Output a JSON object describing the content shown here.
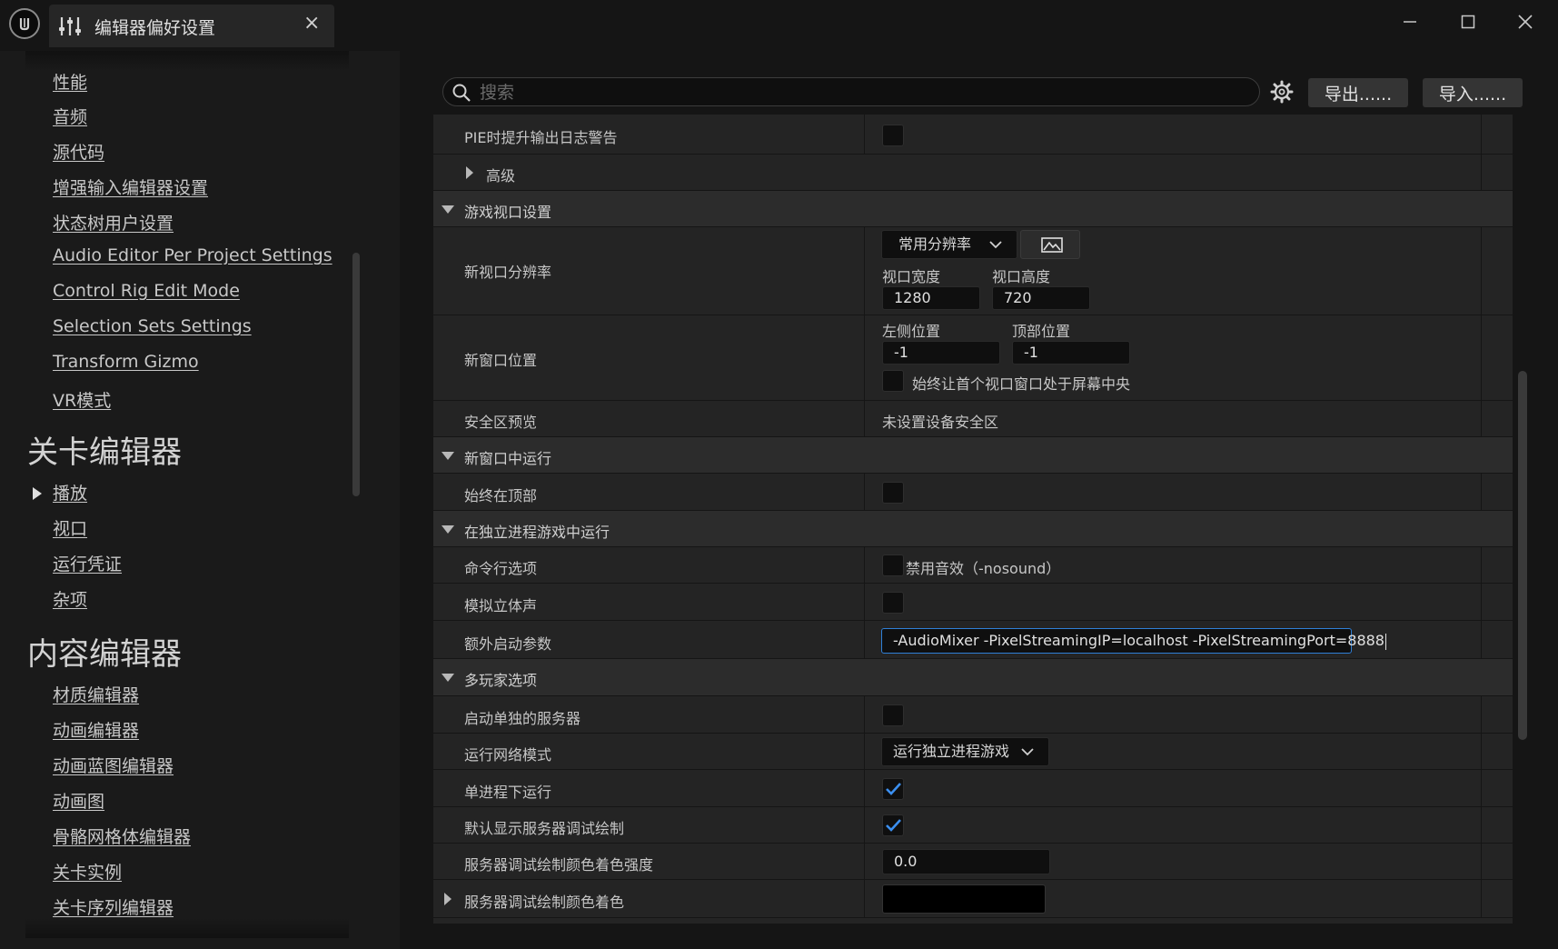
{
  "window": {
    "tab_title": "编辑器偏好设置",
    "close_symbol": "×",
    "icons": [
      "unreal-logo-icon",
      "sliders-icon",
      "minimize-icon",
      "maximize-icon",
      "close-icon"
    ]
  },
  "sidebar": {
    "top_partial": "性能",
    "group1_items": [
      "音频",
      "源代码",
      "增强输入编辑器设置",
      "状态树用户设置",
      "Audio Editor Per Project Settings",
      "Control Rig Edit Mode",
      "Selection Sets Settings",
      "Transform Gizmo",
      "VR模式"
    ],
    "level_editor_header": "关卡编辑器",
    "level_editor_items": [
      "播放",
      "视口",
      "运行凭证",
      "杂项"
    ],
    "content_editor_header": "内容编辑器",
    "content_editor_items": [
      "材质编辑器",
      "动画编辑器",
      "动画蓝图编辑器",
      "动画图",
      "骨骼网格体编辑器",
      "关卡实例",
      "关卡序列编辑器"
    ]
  },
  "toolbar": {
    "search_placeholder": "搜索",
    "export_label": "导出......",
    "import_label": "导入......"
  },
  "properties": {
    "pie_log_warning": "PIE时提升输出日志警告",
    "advanced": "高级",
    "game_viewport_section": "游戏视口设置",
    "new_viewport_resolution": "新视口分辨率",
    "common_resolution": "常用分辨率",
    "viewport_width_label": "视口宽度",
    "viewport_height_label": "视口高度",
    "viewport_width": "1280",
    "viewport_height": "720",
    "new_window_position": "新窗口位置",
    "left_position_label": "左侧位置",
    "top_position_label": "顶部位置",
    "left_position": "-1",
    "top_position": "-1",
    "center_first_window": "始终让首个视口窗口处于屏幕中央",
    "safe_zone_preview": "安全区预览",
    "safe_zone_value": "未设置设备安全区",
    "new_window_section": "新窗口中运行",
    "always_on_top": "始终在顶部",
    "standalone_section": "在独立进程游戏中运行",
    "command_line_options": "命令行选项",
    "disable_sound": "禁用音效（-nosound）",
    "emulate_stereo": "模拟立体声",
    "extra_launch_params": "额外启动参数",
    "extra_launch_value": "-AudioMixer -PixelStreamingIP=localhost -PixelStreamingPort=8888",
    "multiplayer_section": "多玩家选项",
    "launch_separate_server": "启动单独的服务器",
    "net_mode": "运行网络模式",
    "net_mode_value": "运行独立进程游戏",
    "run_under_one_process": "单进程下运行",
    "show_server_debug": "默认显示服务器调试绘制",
    "server_debug_tint_strength": "服务器调试绘制颜色着色强度",
    "server_debug_tint_strength_value": "0.0",
    "server_debug_tint": "服务器调试绘制颜色着色"
  },
  "checkbox_states": {
    "pie_log_warning": false,
    "center_first_window": false,
    "always_on_top": false,
    "disable_sound": false,
    "emulate_stereo": false,
    "launch_separate_server": false,
    "run_under_one_process": true,
    "show_server_debug": true
  },
  "colors": {
    "accent": "#2f7fd6",
    "checkmark": "#3b8ff0",
    "panel_bg": "#242424",
    "section_bg": "#2c2c2c"
  }
}
